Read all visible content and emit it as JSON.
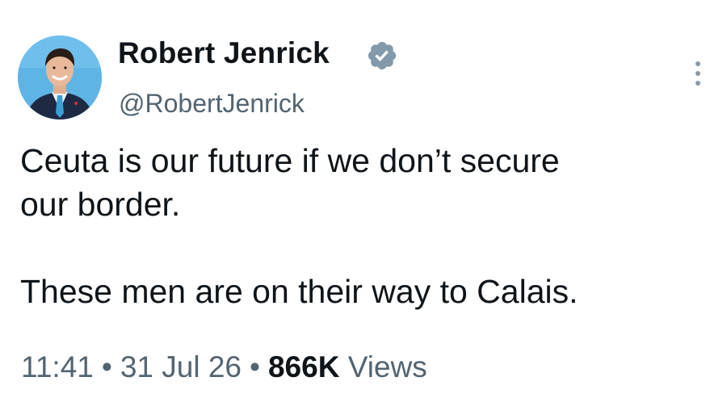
{
  "tweet": {
    "display_name": "Robert Jenrick",
    "handle": "@RobertJenrick",
    "verified": true,
    "text_line1": "Ceuta is our future if we don’t secure",
    "text_line2": "our border.",
    "text_line3": "These men are on their way to Calais.",
    "time": "11:41",
    "date": "31 Jul 26",
    "separator": "•",
    "views_count": "866K",
    "views_label": "Views"
  },
  "icons": {
    "verified": "verified-badge-icon",
    "more": "more-options-icon"
  },
  "colors": {
    "text_primary": "#0f1419",
    "text_secondary": "#536471",
    "verified_badge": "#829aab",
    "avatar_background": "#5fb4e6"
  }
}
